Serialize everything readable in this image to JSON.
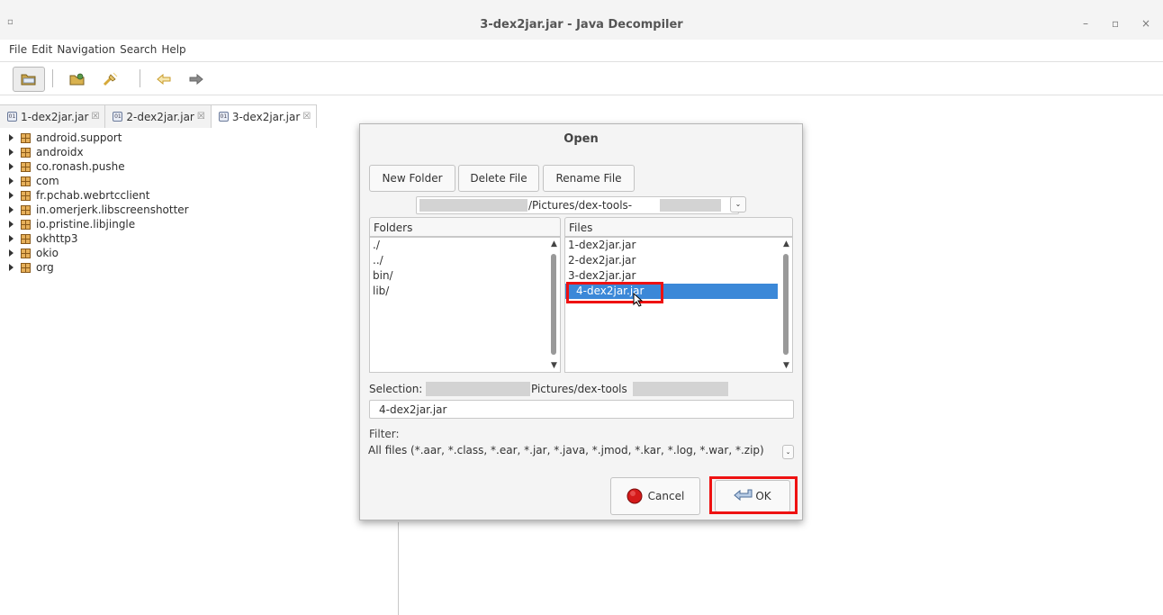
{
  "window": {
    "app_menu_glyph": "▫",
    "title": "3-dex2jar.jar - Java Decompiler",
    "minimize_glyph": "–",
    "maximize_glyph": "▫",
    "close_glyph": "×"
  },
  "menu": [
    "File",
    "Edit",
    "Navigation",
    "Search",
    "Help"
  ],
  "toolbar": {
    "buttons": [
      "open-file",
      "open-type",
      "open-type-hierarchy",
      "back",
      "forward"
    ]
  },
  "tabs": [
    {
      "label": "1-dex2jar.jar",
      "active": false
    },
    {
      "label": "2-dex2jar.jar",
      "active": false
    },
    {
      "label": "3-dex2jar.jar",
      "active": true
    }
  ],
  "tab_close_glyph": "☒",
  "tree": [
    "android.support",
    "androidx",
    "co.ronash.pushe",
    "com",
    "fr.pchab.webrtcclient",
    "in.omerjerk.libscreenshotter",
    "io.pristine.libjingle",
    "okhttp3",
    "okio",
    "org"
  ],
  "dialog": {
    "title": "Open",
    "new_folder": "New Folder",
    "delete_file": "Delete File",
    "rename_file": "Rename File",
    "path_middle": "/Pictures/dex-tools-",
    "folders_header": "Folders",
    "folders": [
      "./",
      "../",
      "bin/",
      "lib/"
    ],
    "files_header": "Files",
    "files": [
      "1-dex2jar.jar",
      "2-dex2jar.jar",
      "3-dex2jar.jar",
      "4-dex2jar.jar"
    ],
    "selected_file_index": 3,
    "selection_label": "Selection:",
    "selection_path_middle": "Pictures/dex-tools",
    "selection_value": "4-dex2jar.jar",
    "filter_label": "Filter:",
    "filter_value": "All files (*.aar, *.class, *.ear, *.jar, *.java, *.jmod, *.kar, *.log, *.war, *.zip)",
    "cancel": "Cancel",
    "ok": "OK"
  },
  "colors": {
    "selection": "#3b88d8",
    "highlight_box": "#ee1111"
  }
}
